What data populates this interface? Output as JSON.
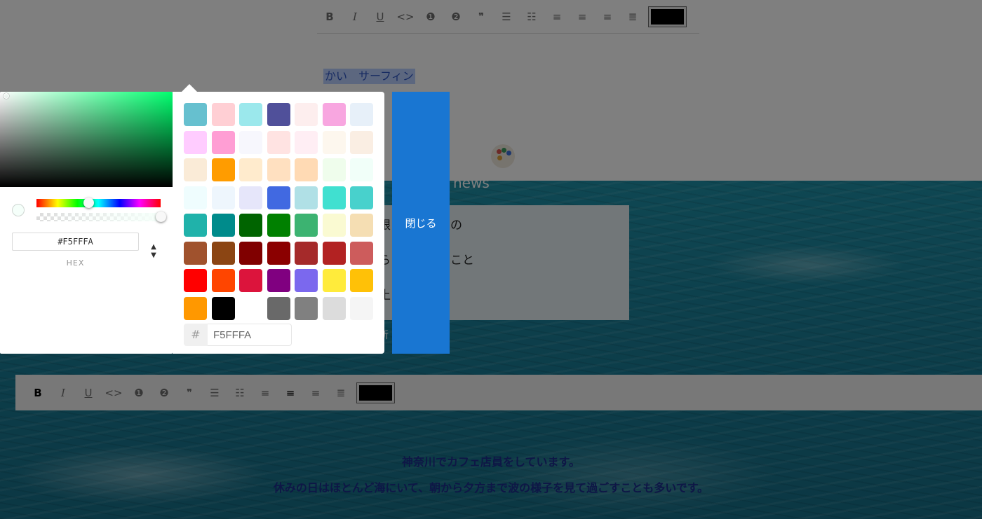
{
  "editor_top": {
    "toolbar": [
      {
        "name": "bold-button",
        "glyph": "B",
        "cls": "bold"
      },
      {
        "name": "italic-button",
        "glyph": "I",
        "cls": "italic"
      },
      {
        "name": "underline-button",
        "glyph": "U",
        "cls": "underline"
      },
      {
        "name": "code-button",
        "glyph": "<>",
        "cls": ""
      },
      {
        "name": "heading-one-button",
        "glyph": "❶",
        "cls": ""
      },
      {
        "name": "heading-two-button",
        "glyph": "❷",
        "cls": ""
      },
      {
        "name": "quote-button",
        "glyph": "❞",
        "cls": ""
      },
      {
        "name": "numbered-list-button",
        "glyph": "☰",
        "cls": ""
      },
      {
        "name": "bulleted-list-button",
        "glyph": "☷",
        "cls": ""
      },
      {
        "name": "align-left-button",
        "glyph": "≡",
        "cls": ""
      },
      {
        "name": "align-center-button",
        "glyph": "≡",
        "cls": ""
      },
      {
        "name": "align-right-button",
        "glyph": "≡",
        "cls": ""
      },
      {
        "name": "align-justify-button",
        "glyph": "≣",
        "cls": ""
      }
    ],
    "color_value": "#000000",
    "selected_text": "かい　サーフィン"
  },
  "news": {
    "title": "news",
    "items": [
      "眼　　れるもの",
      "ら　　続けること",
      "土　　土日"
    ],
    "new_link": "新"
  },
  "editor_bottom": {
    "toolbar": [
      {
        "name": "bold-button",
        "glyph": "B",
        "cls": "bold active"
      },
      {
        "name": "italic-button",
        "glyph": "I",
        "cls": "italic"
      },
      {
        "name": "underline-button",
        "glyph": "U",
        "cls": "underline"
      },
      {
        "name": "code-button",
        "glyph": "<>",
        "cls": ""
      },
      {
        "name": "heading-one-button",
        "glyph": "❶",
        "cls": ""
      },
      {
        "name": "heading-two-button",
        "glyph": "❷",
        "cls": ""
      },
      {
        "name": "quote-button",
        "glyph": "❞",
        "cls": ""
      },
      {
        "name": "numbered-list-button",
        "glyph": "☰",
        "cls": ""
      },
      {
        "name": "bulleted-list-button",
        "glyph": "☷",
        "cls": ""
      },
      {
        "name": "align-left-button",
        "glyph": "≡",
        "cls": ""
      },
      {
        "name": "align-center-button",
        "glyph": "≡",
        "cls": "active"
      },
      {
        "name": "align-right-button",
        "glyph": "≡",
        "cls": ""
      },
      {
        "name": "align-justify-button",
        "glyph": "≣",
        "cls": ""
      }
    ],
    "color_value": "#000000"
  },
  "intro": {
    "line1": "神奈川でカフェ店員をしています。",
    "line2": "休みの日はほとんど海にいて、朝から夕方まで波の様子を見て過ごすことも多いです。"
  },
  "color_picker": {
    "hex_value": "#F5FFFA",
    "hex_label": "HEX",
    "preview_color": "#F5FFFA",
    "hue_level": 0.42,
    "alpha_level": 1.0,
    "mode_toggle_glyph": "▲▼"
  },
  "swatch_panel": {
    "swatches": [
      "#66c0cf",
      "#ffcfd4",
      "#9be8ec",
      "#50509a",
      "#fdeeee",
      "#f8a6e0",
      "#e7f0f9",
      "#ffccff",
      "#ff9ed4",
      "#f7f7fd",
      "#ffe3e2",
      "#ffeef4",
      "#fdf7ee",
      "#faeee3",
      "#faebd7",
      "#ff9c00",
      "#ffebcd",
      "#ffe0c0",
      "#ffdab4",
      "#effdec",
      "#f1fff9",
      "#effdfe",
      "#eef6fd",
      "#e6e6fa",
      "#4169e1",
      "#b0e0e6",
      "#40e0d0",
      "#48d1cc",
      "#20b2aa",
      "#008b8b",
      "#006400",
      "#008000",
      "#3cb371",
      "#fafad2",
      "#f5deb3",
      "#a0522d",
      "#8b4513",
      "#800000",
      "#8b0000",
      "#a52a2a",
      "#b22222",
      "#cd5c5c",
      "#ff0000",
      "#ff4500",
      "#dc143c",
      "#800080",
      "#7b68ee",
      "#ffeb3b",
      "#ffc107",
      "#ff9800",
      "#000000",
      "#ffffff",
      "#696969",
      "#808080",
      "#dcdcdc",
      "#f5f5f5"
    ],
    "hash_symbol": "#",
    "input_value": "F5FFFA"
  },
  "close_button": {
    "label": "閉じる"
  }
}
